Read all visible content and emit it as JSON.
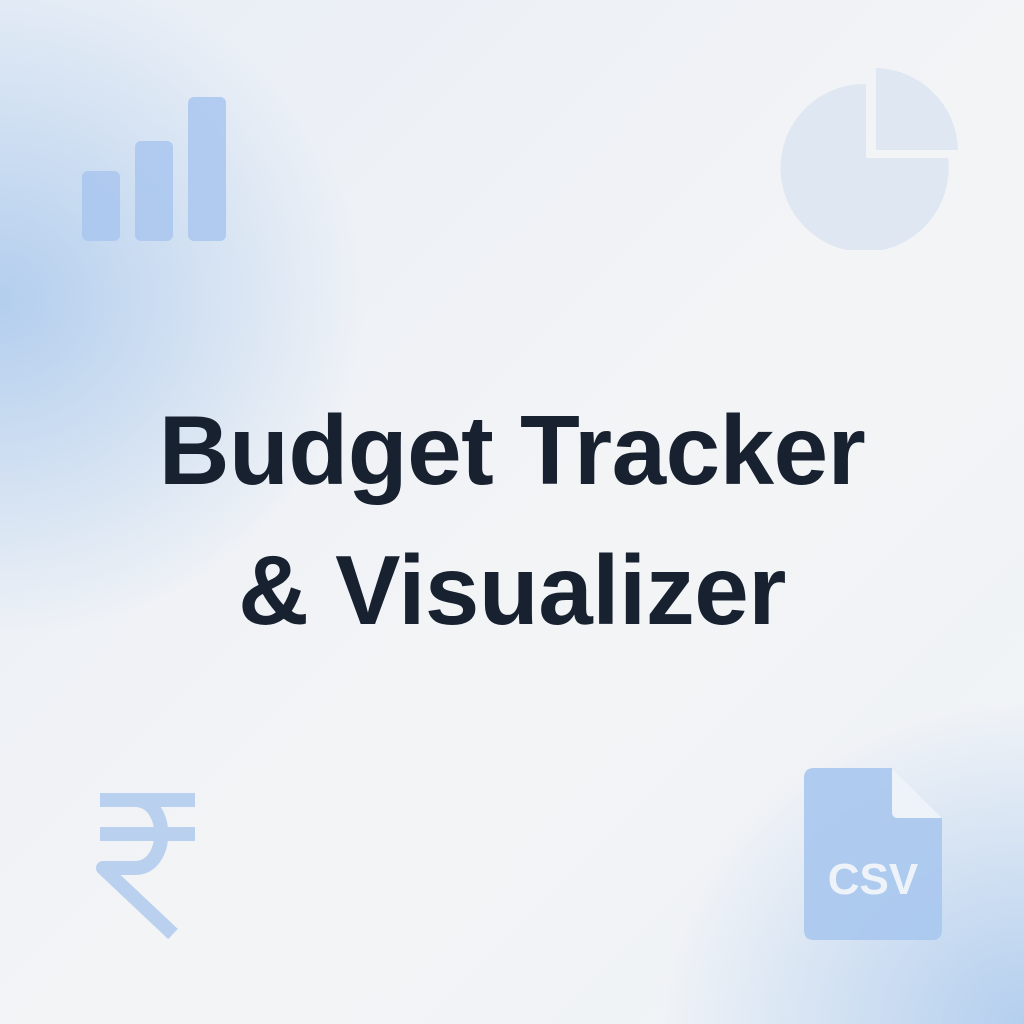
{
  "title": {
    "line1": "Budget Tracker",
    "line2": "& Visualizer"
  },
  "icons": {
    "bar_chart": "bar-chart-icon",
    "pie_chart": "pie-chart-icon",
    "currency": "rupee-icon",
    "file": "csv-file-icon",
    "file_label": "CSV"
  },
  "colors": {
    "title": "#17212f",
    "icon_blue": "#a9c6ee",
    "icon_pale": "#dfe7f2",
    "background_accent": "#a0c3eb"
  }
}
